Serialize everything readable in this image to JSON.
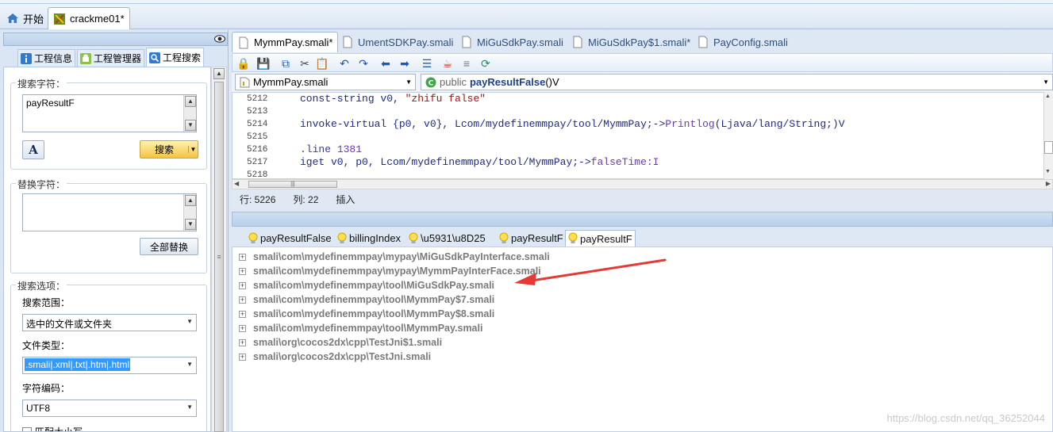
{
  "top_tabs": [
    {
      "label": "开始",
      "icon": "home-icon"
    },
    {
      "label": "crackme01*",
      "icon": "android-project-icon"
    }
  ],
  "left_tabs": [
    {
      "label": "工程信息",
      "icon": "info-icon"
    },
    {
      "label": "工程管理器",
      "icon": "android-icon"
    },
    {
      "label": "工程搜索",
      "icon": "search-icon"
    }
  ],
  "search": {
    "group_label": "搜索字符：",
    "value": "payResultF",
    "button": "搜索"
  },
  "replace": {
    "group_label": "替换字符：",
    "value": "",
    "button": "全部替换"
  },
  "options": {
    "group_label": "搜索选项：",
    "scope_label": "搜索范围：",
    "scope_value": "选中的文件或文件夹",
    "type_label": "文件类型：",
    "type_value": ".smali|.xml|.txt|.htm|.html",
    "encoding_label": "字符编码：",
    "encoding_value": "UTF8",
    "match_case": "匹配大小写"
  },
  "editor_tabs": [
    "MymmPay.smali*",
    "UmentSDKPay.smali",
    "MiGuSdkPay.smali",
    "MiGuSdkPay$1.smali*",
    "PayConfig.smali"
  ],
  "file_combo": "MymmPay.smali",
  "method_combo": {
    "modifier": "public",
    "name": "payResultFalse",
    "sig": "()V"
  },
  "code_lines": [
    {
      "num": "5212",
      "parts": [
        {
          "t": "const-string v0, ",
          "c": "kw"
        },
        {
          "t": "\"zhifu false\"",
          "c": "st"
        }
      ]
    },
    {
      "num": "5213",
      "parts": []
    },
    {
      "num": "5214",
      "parts": [
        {
          "t": "invoke-virtual {p0, v0}, Lcom/mydefinemmpay/tool/MymmPay;->",
          "c": "kw"
        },
        {
          "t": "Printlog",
          "c": "nm"
        },
        {
          "t": "(Ljava/lang/String;)V",
          "c": "kw"
        }
      ]
    },
    {
      "num": "5215",
      "parts": []
    },
    {
      "num": "5216",
      "parts": [
        {
          "t": ".line ",
          "c": "lb"
        },
        {
          "t": "1381",
          "c": "nm"
        }
      ]
    },
    {
      "num": "5217",
      "parts": [
        {
          "t": "iget v0, p0, Lcom/mydefinemmpay/tool/MymmPay;->",
          "c": "kw"
        },
        {
          "t": "falseTime:I",
          "c": "nm"
        }
      ]
    },
    {
      "num": "5218",
      "parts": []
    }
  ],
  "status": {
    "row": "行: 5226",
    "col": "列: 22",
    "mode": "插入"
  },
  "result_tabs": [
    "payResultFalse",
    "billingIndex",
    "\\u5931\\u8D25",
    "payResultF",
    "payResultF"
  ],
  "results": [
    "smali\\com\\mydefinemmpay\\mypay\\MiGuSdkPayInterface.smali",
    "smali\\com\\mydefinemmpay\\mypay\\MymmPayInterFace.smali",
    "smali\\com\\mydefinemmpay\\tool\\MiGuSdkPay.smali",
    "smali\\com\\mydefinemmpay\\tool\\MymmPay$7.smali",
    "smali\\com\\mydefinemmpay\\tool\\MymmPay$8.smali",
    "smali\\com\\mydefinemmpay\\tool\\MymmPay.smali",
    "smali\\org\\cocos2dx\\cpp\\TestJni$1.smali",
    "smali\\org\\cocos2dx\\cpp\\TestJni.smali"
  ],
  "watermark": "https://blog.csdn.net/qq_36252044",
  "colors": {
    "annotation_arrow": "#e53935",
    "panel_bg": "#dae6f3",
    "header_bg": "#bcd1ea"
  }
}
